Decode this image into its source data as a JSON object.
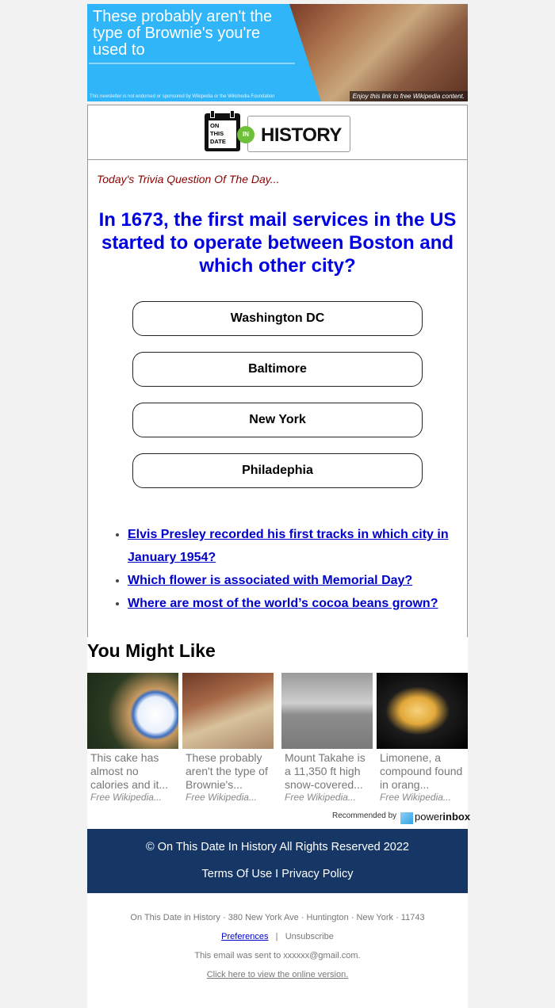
{
  "banner": {
    "title": "These probably aren't the type of Brownie's you're used to",
    "disclaimer": "This newsletter is not endorsed or sponsored by Wikipedia or the Wikimedia Foundation",
    "enjoy": "Enjoy this link to free Wikipedia content."
  },
  "logo": {
    "calendar_lines": [
      "ON",
      "THIS",
      "DATE"
    ],
    "in": "IN",
    "history": "HISTORY"
  },
  "trivia": {
    "label": "Today's Trivia Question Of The Day...",
    "question": "In 1673, the first mail services in the US started to operate between Boston and which other city?",
    "answers": [
      "Washington DC",
      "Baltimore",
      "New York",
      "Philadephia"
    ]
  },
  "more_questions": [
    "Elvis Presley recorded his first tracks in which city in January 1954?",
    "Which flower is associated with Memorial Day?",
    "Where are most of the world’s cocoa beans grown?"
  ],
  "you_might_like": {
    "title": "You Might Like",
    "tiles": [
      {
        "text": "This cake has almost no calories and it...",
        "source": "Free Wikipedia..."
      },
      {
        "text": "These probably aren't the type of Brownie's...",
        "source": "Free Wikipedia..."
      },
      {
        "text": "Mount Takahe is a 11,350 ft high snow-covered...",
        "source": "Free Wikipedia..."
      },
      {
        "text": "Limonene, a compound found in orang...",
        "source": "Free Wikipedia..."
      }
    ],
    "recommended_by": "Recommended by",
    "brand_power": "power",
    "brand_inbox": "inbox"
  },
  "footer": {
    "copyright": "© On This Date In History All Rights Reserved 2022",
    "terms": "Terms Of Use I Privacy Policy"
  },
  "bottom": {
    "address": "On This Date in History · 380 New York Ave · Huntington · New York · 11743",
    "preferences": "Preferences",
    "separator": "|",
    "unsubscribe": "Unsubscribe",
    "sent_to": "This email was sent to xxxxxx@gmail.com.",
    "online": "Click here to view the online version."
  }
}
